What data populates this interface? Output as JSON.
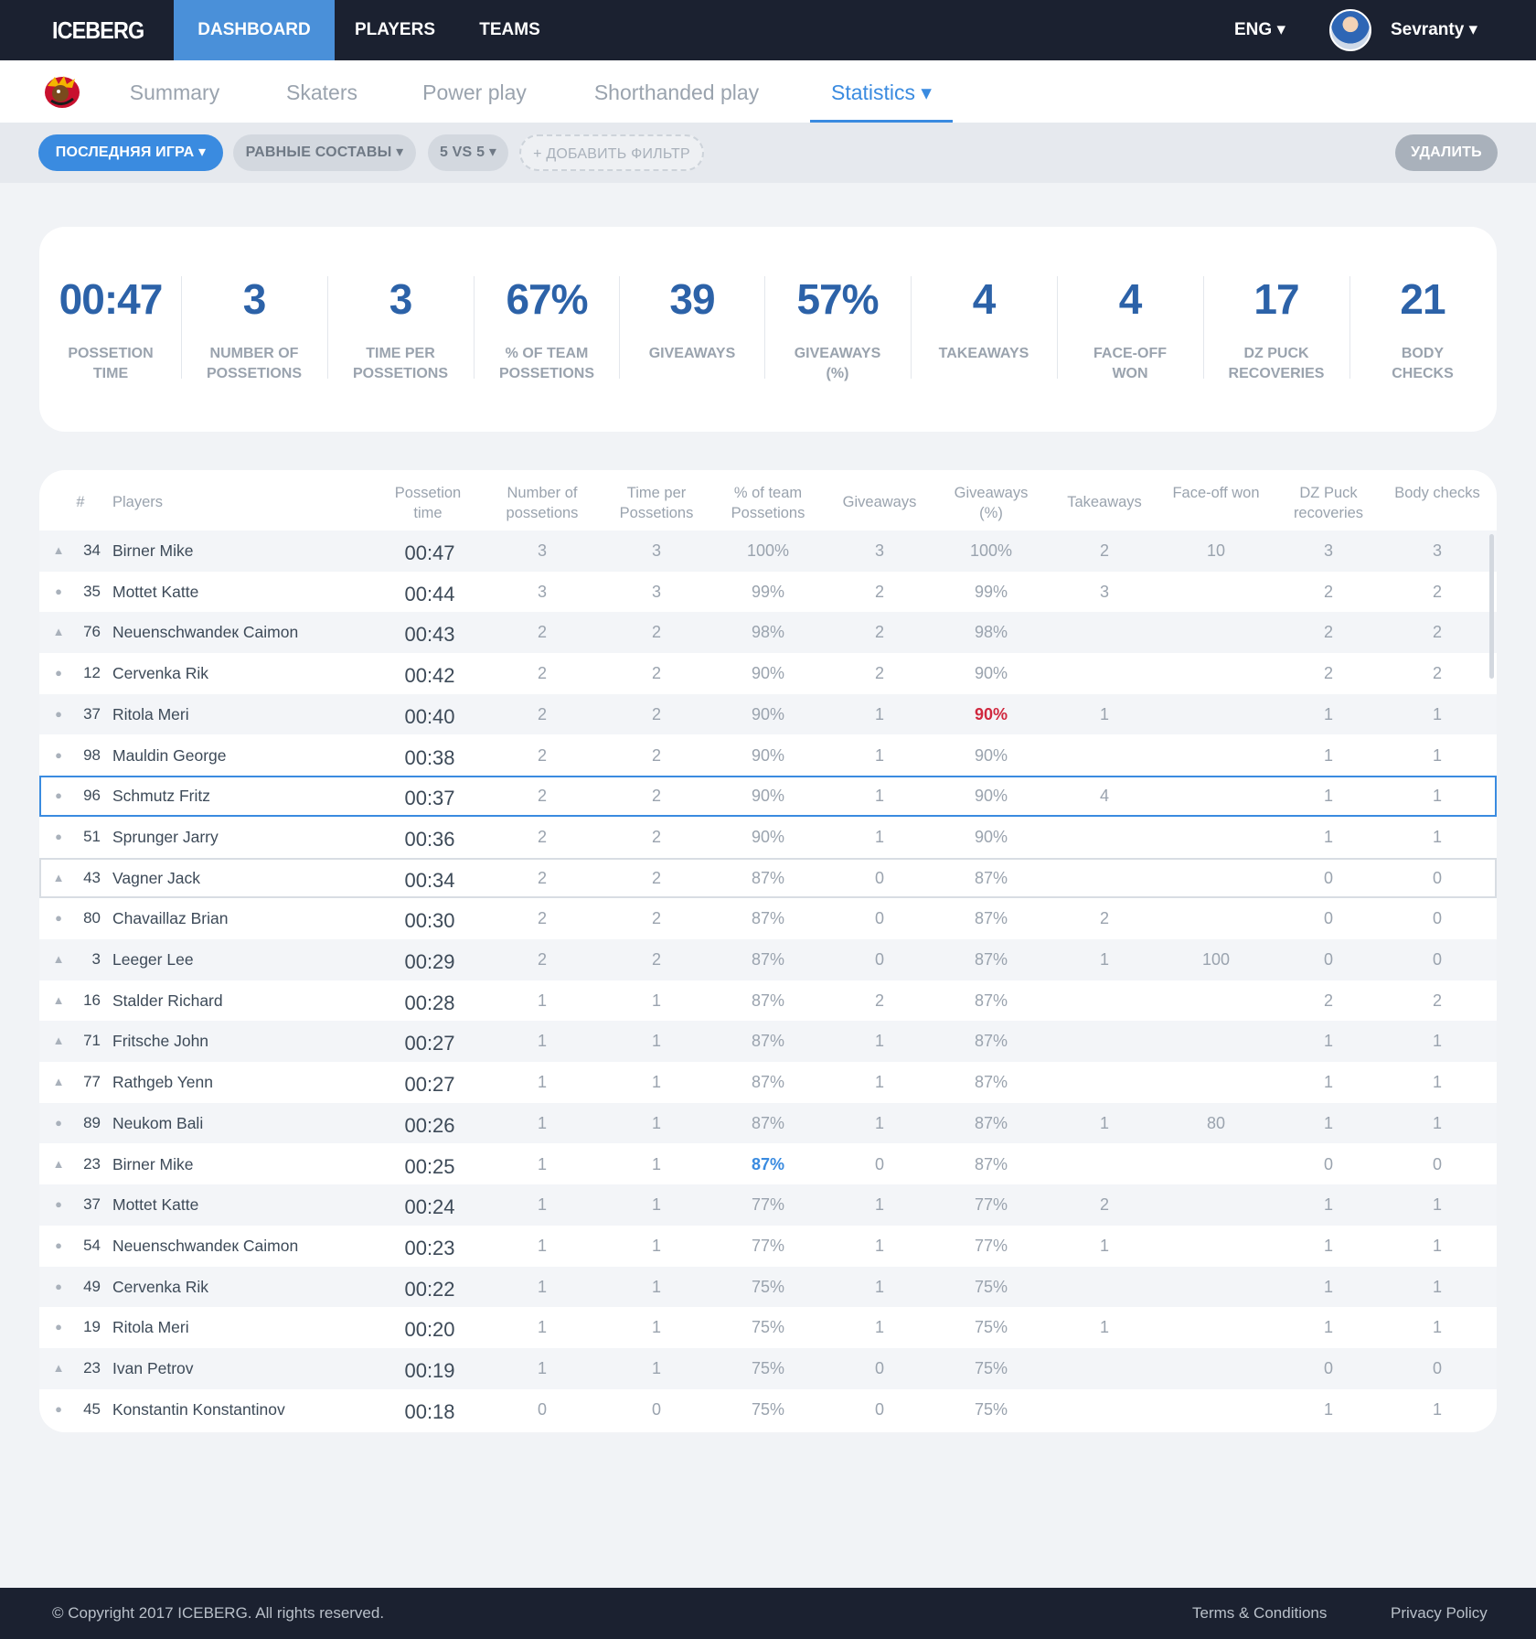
{
  "brand": "ICEBERG",
  "nav": {
    "dashboard": "DASHBOARD",
    "players": "PLAYERS",
    "teams": "TEAMS"
  },
  "lang": "ENG ▾",
  "user": "Sevranty ▾",
  "tabs": {
    "summary": "Summary",
    "skaters": "Skaters",
    "power_play": "Power play",
    "shorthanded": "Shorthanded play",
    "statistics": "Statistics ▾"
  },
  "filters": {
    "last_game": "ПОСЛЕДНЯЯ ИГРА ▾",
    "equal": "РАВНЫЕ СОСТАВЫ ▾",
    "vs": "5 VS 5 ▾",
    "add": "+ ДОБАВИТЬ ФИЛЬТР",
    "delete": "УДАЛИТЬ"
  },
  "summary": [
    {
      "value": "00:47",
      "label": "POSSETION TIME"
    },
    {
      "value": "3",
      "label": "NUMBER OF POSSETIONS"
    },
    {
      "value": "3",
      "label": "TIME PER POSSETIONS"
    },
    {
      "value": "67%",
      "label": "% OF TEAM POSSETIONS"
    },
    {
      "value": "39",
      "label": "GIVEAWAYS"
    },
    {
      "value": "57%",
      "label": "GIVEAWAYS (%)"
    },
    {
      "value": "4",
      "label": "TAKEAWAYS"
    },
    {
      "value": "4",
      "label": "FACE-OFF WON"
    },
    {
      "value": "17",
      "label": "DZ PUCK RECOVERIES"
    },
    {
      "value": "21",
      "label": "BODY CHECKS"
    }
  ],
  "table": {
    "headers": [
      "#",
      "Players",
      "Possetion time",
      "Number of possetions",
      "Time per Possetions",
      "% of team Possetions",
      "Giveaways",
      "Giveaways (%)",
      "Takeaways",
      "Face-off won",
      "DZ Puck recoveries",
      "Body checks"
    ],
    "rows": [
      {
        "marker": "▲",
        "num": "34",
        "name": "Birner Mike",
        "time": "00:47",
        "nposs": "3",
        "tposs": "3",
        "pct": "100%",
        "give": "3",
        "givepct": "100%",
        "take": "2",
        "face": "10",
        "dz": "3",
        "body": "3"
      },
      {
        "marker": "●",
        "num": "35",
        "name": "Mottet Katte",
        "time": "00:44",
        "nposs": "3",
        "tposs": "3",
        "pct": "99%",
        "give": "2",
        "givepct": "99%",
        "take": "3",
        "face": "",
        "dz": "2",
        "body": "2"
      },
      {
        "marker": "▲",
        "num": "76",
        "name": "Neuenschwandeк Caimon",
        "time": "00:43",
        "nposs": "2",
        "tposs": "2",
        "pct": "98%",
        "give": "2",
        "givepct": "98%",
        "take": "",
        "face": "",
        "dz": "2",
        "body": "2"
      },
      {
        "marker": "●",
        "num": "12",
        "name": "Cervenka Rik",
        "time": "00:42",
        "nposs": "2",
        "tposs": "2",
        "pct": "90%",
        "give": "2",
        "givepct": "90%",
        "take": "",
        "face": "",
        "dz": "2",
        "body": "2"
      },
      {
        "marker": "●",
        "num": "37",
        "name": "Ritola Meri",
        "time": "00:40",
        "nposs": "2",
        "tposs": "2",
        "pct": "90%",
        "give": "1",
        "givepct": "90%",
        "take": "1",
        "face": "",
        "dz": "1",
        "body": "1"
      },
      {
        "marker": "●",
        "num": "98",
        "name": "Mauldin George",
        "time": "00:38",
        "nposs": "2",
        "tposs": "2",
        "pct": "90%",
        "give": "1",
        "givepct": "90%",
        "take": "",
        "face": "",
        "dz": "1",
        "body": "1"
      },
      {
        "marker": "●",
        "num": "96",
        "name": "Schmutz Fritz",
        "time": "00:37",
        "nposs": "2",
        "tposs": "2",
        "pct": "90%",
        "give": "1",
        "givepct": "90%",
        "take": "4",
        "face": "",
        "dz": "1",
        "body": "1"
      },
      {
        "marker": "●",
        "num": "51",
        "name": "Sprunger Jarry",
        "time": "00:36",
        "nposs": "2",
        "tposs": "2",
        "pct": "90%",
        "give": "1",
        "givepct": "90%",
        "take": "",
        "face": "",
        "dz": "1",
        "body": "1"
      },
      {
        "marker": "▲",
        "num": "43",
        "name": "Vagner Jack",
        "time": "00:34",
        "nposs": "2",
        "tposs": "2",
        "pct": "87%",
        "give": "0",
        "givepct": "87%",
        "take": "",
        "face": "",
        "dz": "0",
        "body": "0"
      },
      {
        "marker": "●",
        "num": "80",
        "name": "Chavaillaz Brian",
        "time": "00:30",
        "nposs": "2",
        "tposs": "2",
        "pct": "87%",
        "give": "0",
        "givepct": "87%",
        "take": "2",
        "face": "",
        "dz": "0",
        "body": "0"
      },
      {
        "marker": "▲",
        "num": "3",
        "name": "Leeger Lee",
        "time": "00:29",
        "nposs": "2",
        "tposs": "2",
        "pct": "87%",
        "give": "0",
        "givepct": "87%",
        "take": "1",
        "face": "100",
        "dz": "0",
        "body": "0"
      },
      {
        "marker": "▲",
        "num": "16",
        "name": "Stalder Richard",
        "time": "00:28",
        "nposs": "1",
        "tposs": "1",
        "pct": "87%",
        "give": "2",
        "givepct": "87%",
        "take": "",
        "face": "",
        "dz": "2",
        "body": "2"
      },
      {
        "marker": "▲",
        "num": "71",
        "name": "Fritsche John",
        "time": "00:27",
        "nposs": "1",
        "tposs": "1",
        "pct": "87%",
        "give": "1",
        "givepct": "87%",
        "take": "",
        "face": "",
        "dz": "1",
        "body": "1"
      },
      {
        "marker": "▲",
        "num": "77",
        "name": "Rathgeb Yenn",
        "time": "00:27",
        "nposs": "1",
        "tposs": "1",
        "pct": "87%",
        "give": "1",
        "givepct": "87%",
        "take": "",
        "face": "",
        "dz": "1",
        "body": "1"
      },
      {
        "marker": "●",
        "num": "89",
        "name": "Neukom Bali",
        "time": "00:26",
        "nposs": "1",
        "tposs": "1",
        "pct": "87%",
        "give": "1",
        "givepct": "87%",
        "take": "1",
        "face": "80",
        "dz": "1",
        "body": "1"
      },
      {
        "marker": "▲",
        "num": "23",
        "name": "Birner Mike",
        "time": "00:25",
        "nposs": "1",
        "tposs": "1",
        "pct": "87%",
        "give": "0",
        "givepct": "87%",
        "take": "",
        "face": "",
        "dz": "0",
        "body": "0"
      },
      {
        "marker": "●",
        "num": "37",
        "name": "Mottet Katte",
        "time": "00:24",
        "nposs": "1",
        "tposs": "1",
        "pct": "77%",
        "give": "1",
        "givepct": "77%",
        "take": "2",
        "face": "",
        "dz": "1",
        "body": "1"
      },
      {
        "marker": "●",
        "num": "54",
        "name": "Neuenschwandeк Caimon",
        "time": "00:23",
        "nposs": "1",
        "tposs": "1",
        "pct": "77%",
        "give": "1",
        "givepct": "77%",
        "take": "1",
        "face": "",
        "dz": "1",
        "body": "1"
      },
      {
        "marker": "●",
        "num": "49",
        "name": "Cervenka Rik",
        "time": "00:22",
        "nposs": "1",
        "tposs": "1",
        "pct": "75%",
        "give": "1",
        "givepct": "75%",
        "take": "",
        "face": "",
        "dz": "1",
        "body": "1"
      },
      {
        "marker": "●",
        "num": "19",
        "name": "Ritola Meri",
        "time": "00:20",
        "nposs": "1",
        "tposs": "1",
        "pct": "75%",
        "give": "1",
        "givepct": "75%",
        "take": "1",
        "face": "",
        "dz": "1",
        "body": "1"
      },
      {
        "marker": "▲",
        "num": "23",
        "name": "Ivan Petrov",
        "time": "00:19",
        "nposs": "1",
        "tposs": "1",
        "pct": "75%",
        "give": "0",
        "givepct": "75%",
        "take": "",
        "face": "",
        "dz": "0",
        "body": "0"
      },
      {
        "marker": "●",
        "num": "45",
        "name": "Konstantin Konstantinov",
        "time": "00:18",
        "nposs": "0",
        "tposs": "0",
        "pct": "75%",
        "give": "0",
        "givepct": "75%",
        "take": "",
        "face": "",
        "dz": "1",
        "body": "1"
      }
    ]
  },
  "footer": {
    "copyright": "© Copyright 2017 ICEBERG. All rights reserved.",
    "terms": "Terms & Conditions",
    "privacy": "Privacy Policy"
  },
  "colors": {
    "accent": "#3a8be0",
    "nav_bg": "#1b2130",
    "stat_value": "#2c62a8",
    "alert": "#d0283f"
  }
}
